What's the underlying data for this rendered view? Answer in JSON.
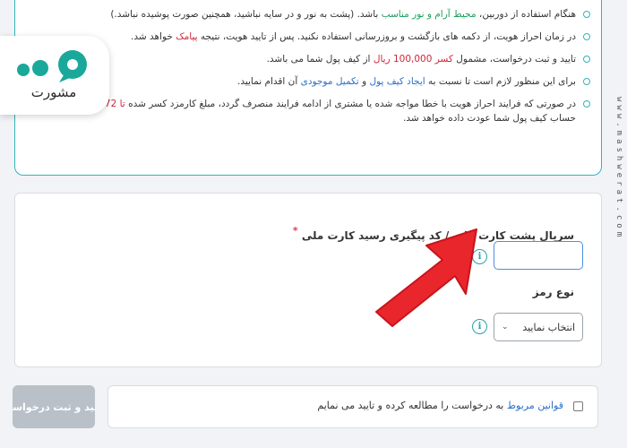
{
  "instructions": [
    {
      "segments": [
        {
          "text": "هنگام استفاده از دوربین، "
        },
        {
          "text": "محیط آرام و نور مناسب",
          "style": "hl-green"
        },
        {
          "text": " باشد. (پشت به نور و در سایه نباشید، همچنین صورت پوشیده نباشد.)"
        }
      ]
    },
    {
      "segments": [
        {
          "text": "در زمان احراز هویت، از دکمه های بازگشت و بروزرسانی استفاده نکنید. پس از تایید هویت، نتیجه "
        },
        {
          "text": "پیامک",
          "style": "hl-red"
        },
        {
          "text": " خواهد شد."
        }
      ]
    },
    {
      "segments": [
        {
          "text": "تایید و ثبت درخواست، مشمول "
        },
        {
          "text": "کسر 100,000 ریال",
          "style": "hl-red"
        },
        {
          "text": " از کیف پول شما می باشد."
        }
      ]
    },
    {
      "segments": [
        {
          "text": "برای این منظور لازم است تا نسبت به "
        },
        {
          "text": "ایجاد کیف پول",
          "style": "hl-blue"
        },
        {
          "text": " و "
        },
        {
          "text": "تکمیل موجودی",
          "style": "hl-blue"
        },
        {
          "text": " آن اقدام نمایید."
        }
      ]
    },
    {
      "segments": [
        {
          "text": "در صورتی که فرایند احراز هویت با خطا مواجه شده یا مشتری از ادامه فرایند منصرف گردد، مبلغ کارمزد کسر شده "
        },
        {
          "text": "تا 72 ساعت",
          "style": "hl-red"
        },
        {
          "text": " به حساب کیف پول شما عودت داده خواهد شد."
        }
      ]
    }
  ],
  "form": {
    "serial_label": "سریال پشت کارت ملی / کد پیگیری رسید کارت ملی",
    "required_mark": "*",
    "serial_value": "",
    "info_glyph": "i",
    "type_label": "نوع رمز",
    "type_select_value": "انتخاب نمایید",
    "chevron_glyph": "⌄"
  },
  "footer": {
    "submit_label": "تایید و ثبت درخواست",
    "terms_link": "قوانین مربوط",
    "terms_rest": " به درخواست را مطالعه کرده و تایید می نمایم"
  },
  "logo": {
    "word": "مشورت"
  },
  "watermark": "www.mashwerat.com",
  "icons": {
    "info": "info-circle-icon",
    "select_arrow": "chevron-down-icon",
    "annotation": "red-arrow-icon",
    "logo": "speech-bubble-logo-icon"
  },
  "colors": {
    "accent": "#34b3b8",
    "highlight_red": "#d0243a",
    "highlight_green": "#1aa05a",
    "highlight_blue": "#2a6fc9",
    "input_border": "#4a90e2",
    "arrow": "#e8262c",
    "submit_disabled": "#b9c0c8"
  }
}
